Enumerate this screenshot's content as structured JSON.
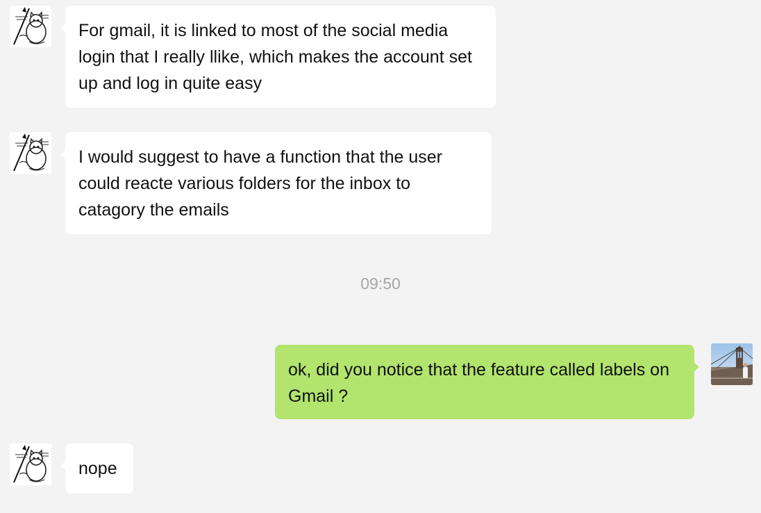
{
  "messages": [
    {
      "from": "other",
      "text": "For gmail, it is linked to most of the social media login that I really llike, which makes the account set up and log in quite easy"
    },
    {
      "from": "other",
      "text": "I would suggest to have a function that the user could reacte various folders for the inbox to catagory the emails"
    },
    {
      "from": "me",
      "text": "ok, did you notice that the feature called labels on Gmail ?"
    },
    {
      "from": "other",
      "text": "nope"
    }
  ],
  "timestamp": "09:50",
  "colors": {
    "background": "#f3f3f3",
    "incoming_bubble": "#ffffff",
    "outgoing_bubble": "#b2e46e",
    "timestamp_text": "#a6a6a6"
  },
  "icons": {
    "other_avatar": "cat-sketch-avatar-icon",
    "my_avatar": "bridge-photo-avatar-icon"
  }
}
